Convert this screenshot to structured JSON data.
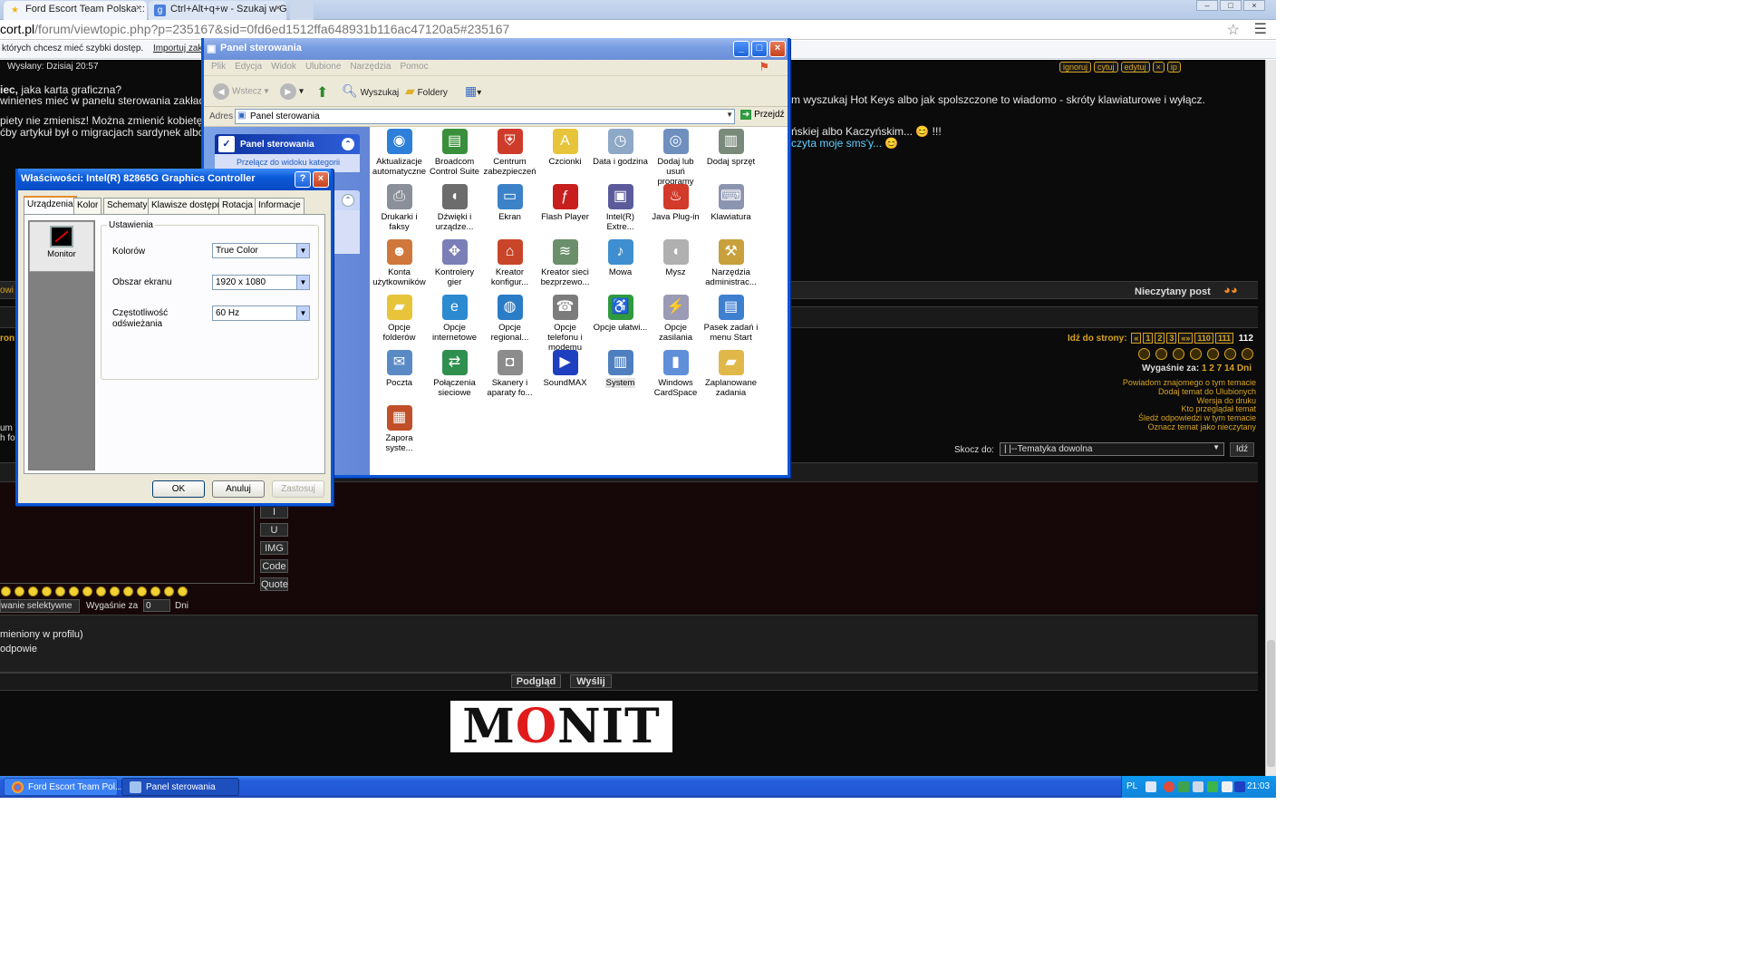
{
  "browser": {
    "tabs": [
      {
        "title": "Ford Escort Team Polska :: Z",
        "close": "×"
      },
      {
        "title": "Ctrl+Alt+q+w - Szukaj w Go",
        "close": "×"
      }
    ],
    "url_prefix": "cort.pl",
    "url_rest": "/forum/viewtopic.php?p=235167&sid=0fd6ed1512ffa648931b116ac47120a5#235167",
    "bookmarks_text": "których chcesz mieć szybki dostęp.",
    "bookmarks_import": "Importuj zakładki te",
    "window_buttons": [
      "–",
      "□",
      "×"
    ],
    "star_icon": "star-icon",
    "menu_icon": "menu-icon"
  },
  "forum": {
    "post_header": "Wysłany: Dzisiaj 20:57",
    "post_line1a": "iec,",
    "post_line1b": " jaka karta graficzna?",
    "post_line2": "winienes mieć w panelu sterowania zakładk",
    "post_line3": "piety nie zmienisz! Można zmienić kobietę a",
    "post_line4": "ćby artykuł był o migracjach sardynek albo",
    "right_line1": "m wyszukaj Hot Keys albo jak spolszczone to wiadomo - skróty klawiaturowe i wyłącz.",
    "right_line2": "ńskiej albo Kaczyńskim... 😊 !!!",
    "right_line3": "czyta moje sms'y... 😊",
    "post_buttons": [
      "ignoruj",
      "cytuj",
      "edytuj"
    ],
    "bar_left1": "owi",
    "unread_label": "Nieczytany post",
    "bar_left2": "ron",
    "pagination_label": "Idź do strony:",
    "pages": [
      "«",
      "1",
      "2",
      "3",
      "«»",
      "110",
      "111"
    ],
    "current_page": "112",
    "expiry_label": "Wygaśnie za:",
    "expiry_value": "1 2 7 14 Dni",
    "links": [
      "Powiadom znajomego o tym temacie",
      "Dodaj temat do Ulubionych",
      "Wersja do druku",
      "Kto przeglądał temat",
      "Śledź odpowiedzi w tym temacie",
      "Oznacz temat jako nieczytany"
    ],
    "left_frag1": "um",
    "left_frag2": "h fo",
    "jump_label": "Skocz do:",
    "jump_value": "|  |--Tematyka dowolna",
    "jump_button": "Idź",
    "format_buttons": [
      "I",
      "U",
      "IMG",
      "Code",
      "Quote"
    ],
    "selective_label": "wanie selektywne",
    "expire_label": "Wygaśnie za",
    "expire_value": "0",
    "expire_unit": "Dni",
    "text_line1": "mieniony w profilu)",
    "text_line2": "odpowie",
    "preview_button": "Podgląd",
    "send_button": "Wyślij",
    "banner_pre": "M",
    "banner_o": "O",
    "banner_post": "NIT"
  },
  "control_panel": {
    "title": "Panel sterowania",
    "menu": [
      "Plik",
      "Edycja",
      "Widok",
      "Ulubione",
      "Narzędzia",
      "Pomoc"
    ],
    "toolbar": {
      "back": "Wstecz",
      "search": "Wyszukaj",
      "folders": "Foldery"
    },
    "address_label": "Adres",
    "address_value": "Panel sterowania",
    "go_label": "Przejdź",
    "side_title": "Panel sterowania",
    "side_link": "Przełącz do widoku kategorii",
    "items": [
      {
        "label": "Aktualizacje automatyczne",
        "icon": "windows-update-icon",
        "color": "#2d7fd8"
      },
      {
        "label": "Broadcom Control Suite",
        "icon": "network-card-icon",
        "color": "#3a8f3a"
      },
      {
        "label": "Centrum zabezpieczeń",
        "icon": "security-shield-icon",
        "color": "#cf3b2b"
      },
      {
        "label": "Czcionki",
        "icon": "fonts-folder-icon",
        "color": "#e8c43a"
      },
      {
        "label": "Data i godzina",
        "icon": "clock-icon",
        "color": "#8ea8c8"
      },
      {
        "label": "Dodaj lub usuń programy",
        "icon": "add-remove-programs-icon",
        "color": "#6f8fbf"
      },
      {
        "label": "Dodaj sprzęt",
        "icon": "add-hardware-icon",
        "color": "#7a8a7a"
      },
      {
        "label": "Drukarki i faksy",
        "icon": "printer-icon",
        "color": "#8a8f99"
      },
      {
        "label": "Dźwięki i urządze...",
        "icon": "speaker-icon",
        "color": "#6c6c6c"
      },
      {
        "label": "Ekran",
        "icon": "display-icon",
        "color": "#3c82c8"
      },
      {
        "label": "Flash Player",
        "icon": "flash-player-icon",
        "color": "#c81e1e"
      },
      {
        "label": "Intel(R) Extre...",
        "icon": "intel-graphics-icon",
        "color": "#5b5b9c"
      },
      {
        "label": "Java Plug-in",
        "icon": "java-icon",
        "color": "#d23a2a"
      },
      {
        "label": "Klawiatura",
        "icon": "keyboard-icon",
        "color": "#8c95b0"
      },
      {
        "label": "Konta użytkowników",
        "icon": "user-accounts-icon",
        "color": "#d0783c"
      },
      {
        "label": "Kontrolery gier",
        "icon": "game-controller-icon",
        "color": "#7b7fb7"
      },
      {
        "label": "Kreator konfigur...",
        "icon": "network-setup-icon",
        "color": "#c9452a"
      },
      {
        "label": "Kreator sieci bezprzewo...",
        "icon": "wireless-icon",
        "color": "#6b8f6b"
      },
      {
        "label": "Mowa",
        "icon": "speech-icon",
        "color": "#3f8fd0"
      },
      {
        "label": "Mysz",
        "icon": "mouse-icon",
        "color": "#b0b0b0"
      },
      {
        "label": "Narzędzia administrac...",
        "icon": "admin-tools-icon",
        "color": "#c8a03c"
      },
      {
        "label": "Opcje folderów",
        "icon": "folder-options-icon",
        "color": "#e8c43a"
      },
      {
        "label": "Opcje internetowe",
        "icon": "internet-options-icon",
        "color": "#2b8ad0"
      },
      {
        "label": "Opcje regional...",
        "icon": "globe-icon",
        "color": "#2a7cc6"
      },
      {
        "label": "Opcje telefonu i modemu",
        "icon": "phone-icon",
        "color": "#7c7c7c"
      },
      {
        "label": "Opcje ułatwi...",
        "icon": "accessibility-icon",
        "color": "#2f9a3f"
      },
      {
        "label": "Opcje zasilania",
        "icon": "power-icon",
        "color": "#9b9bb5"
      },
      {
        "label": "Pasek zadań i menu Start",
        "icon": "taskbar-icon",
        "color": "#3f7fd0"
      },
      {
        "label": "Poczta",
        "icon": "mail-icon",
        "color": "#5a8ac5"
      },
      {
        "label": "Połączenia sieciowe",
        "icon": "network-connections-icon",
        "color": "#2f8f4f"
      },
      {
        "label": "Skanery i aparaty fo...",
        "icon": "scanner-icon",
        "color": "#8c8c8c"
      },
      {
        "label": "SoundMAX",
        "icon": "soundmax-icon",
        "color": "#1e3fbf"
      },
      {
        "label": "System",
        "icon": "system-icon",
        "color": "#4f7fbf"
      },
      {
        "label": "Windows CardSpace",
        "icon": "cardspace-icon",
        "color": "#5f8fd9"
      },
      {
        "label": "Zaplanowane zadania",
        "icon": "scheduled-tasks-icon",
        "color": "#e0b84a"
      },
      {
        "label": "Zapora syste...",
        "icon": "firewall-icon",
        "color": "#c0502a"
      }
    ]
  },
  "display_dialog": {
    "title": "Właściwości: Intel(R) 82865G Graphics Controller",
    "tabs": [
      "Urządzenia",
      "Kolor",
      "Schematy",
      "Klawisze dostępu",
      "Rotacja",
      "Informacje"
    ],
    "device": "Monitor",
    "group_label": "Ustawienia",
    "colors_label": "Kolorów",
    "colors_value": "True Color",
    "area_label": "Obszar ekranu",
    "area_value": "1920 x 1080",
    "freq_label_1": "Częstotliwość",
    "freq_label_2": "odświeżania",
    "freq_value": "60 Hz",
    "ok": "OK",
    "cancel": "Anuluj",
    "apply": "Zastosuj"
  },
  "taskbar": {
    "tasks": [
      "Ford Escort Team Pol...",
      "Panel sterowania"
    ],
    "lang": "PL",
    "time": "21:03"
  }
}
